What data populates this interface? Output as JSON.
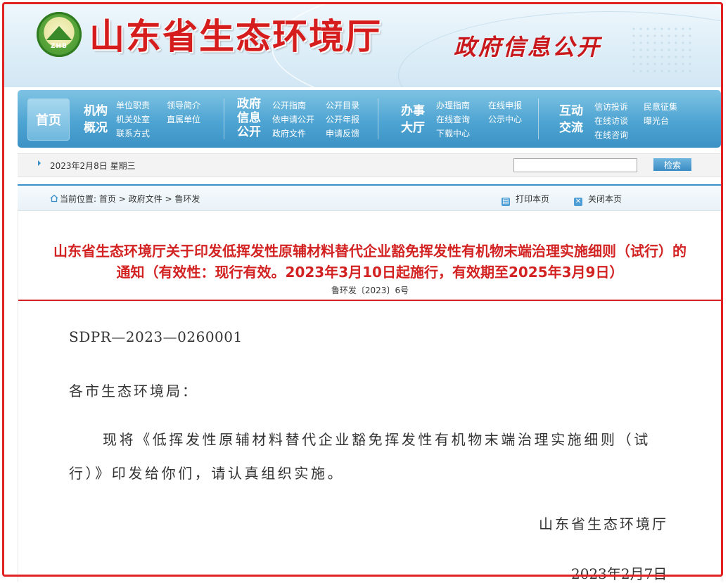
{
  "header": {
    "emblem_text": "ZHB",
    "site_title": "山东省生态环境厅",
    "section_title": "政府信息公开"
  },
  "nav": {
    "home": "首页",
    "groups": [
      {
        "title": [
          "机构",
          "概况"
        ],
        "links": [
          "单位职责",
          "领导简介",
          "机关处室",
          "直属单位",
          "联系方式"
        ]
      },
      {
        "title": [
          "政府",
          "信息",
          "公开"
        ],
        "links": [
          "公开指南",
          "公开目录",
          "依申请公开",
          "公开年报",
          "政府文件",
          "申请反馈"
        ]
      },
      {
        "title": [
          "办事",
          "大厅"
        ],
        "links": [
          "办理指南",
          "在线申报",
          "在线查询",
          "公示中心",
          "下载中心"
        ]
      },
      {
        "title": [
          "互动",
          "交流"
        ],
        "links": [
          "信访投诉",
          "民意征集",
          "在线访谈",
          "曝光台",
          "在线咨询"
        ]
      }
    ]
  },
  "datebar": {
    "date": "2023年2月8日 星期三",
    "search_value": "",
    "search_button": "检索"
  },
  "breadcrumb": {
    "prefix": "当前位置:",
    "items": [
      "首页",
      "政府文件",
      "鲁环发"
    ],
    "separator": ">"
  },
  "tools": {
    "print": "打印本页",
    "close": "关闭本页"
  },
  "document": {
    "title_line1": "山东省生态环境厅关于印发低挥发性原辅材料替代企业豁免挥发性有机物末端治理实施细则（试行）的",
    "title_line2": "通知（有效性：现行有效。2023年3月10日起施行，有效期至2025年3月9日）",
    "doc_number": "鲁环发〔2023〕6号",
    "code": "SDPR—2023—0260001",
    "salutation": "各市生态环境局：",
    "body_line1": "现将《低挥发性原辅材料替代企业豁免挥发性有机物末端治理实施细则（试",
    "body_line2": "行）》印发给你们，请认真组织实施。",
    "signature": "山东省生态环境厅",
    "date": "2023年2月7日"
  }
}
